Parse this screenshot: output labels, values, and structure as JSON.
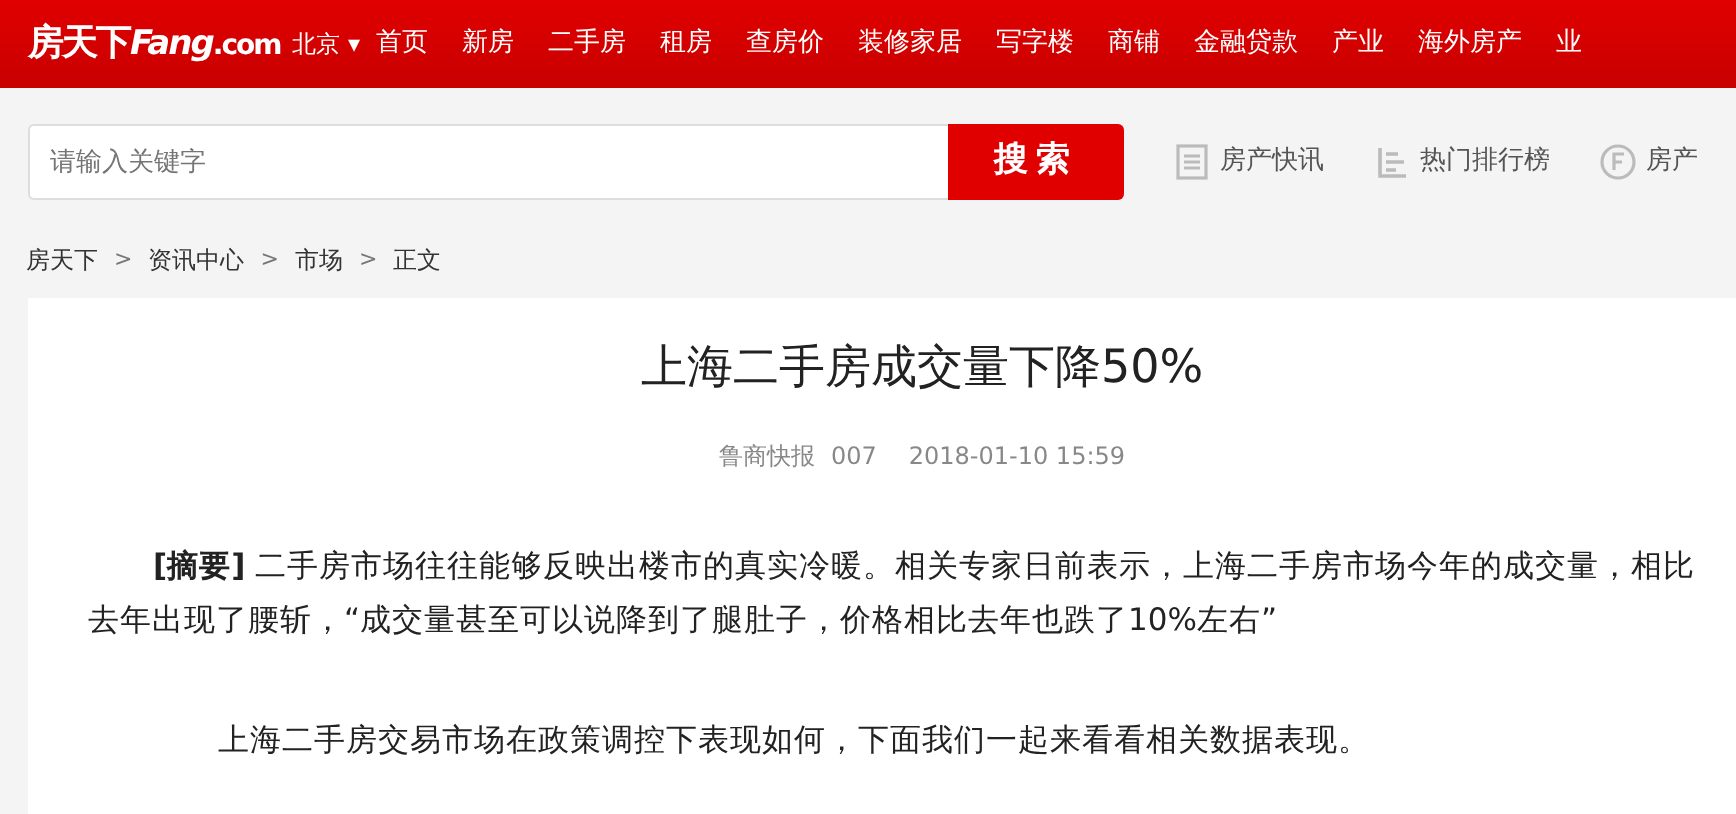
{
  "header": {
    "logo": {
      "cn": "房天下",
      "en": "Fang",
      "domain": ".com"
    },
    "city": "北京",
    "city_caret": "▾",
    "nav": [
      "首页",
      "新房",
      "二手房",
      "租房",
      "查房价",
      "装修家居",
      "写字楼",
      "商铺",
      "金融贷款",
      "产业",
      "海外房产",
      "业"
    ]
  },
  "search": {
    "placeholder": "请输入关键字",
    "button": "搜索"
  },
  "quick_links": [
    {
      "kind": "news",
      "label": "房产快讯"
    },
    {
      "kind": "rank",
      "label": "热门排行榜"
    },
    {
      "kind": "circle",
      "label": "房产"
    }
  ],
  "breadcrumb": [
    {
      "label": "房天下",
      "sep": ">"
    },
    {
      "label": "资讯中心",
      "sep": ">"
    },
    {
      "label": "市场",
      "sep": ">"
    },
    {
      "label": "正文"
    }
  ],
  "article": {
    "title": "上海二手房成交量下降50%",
    "source": "鲁商快报",
    "author": "007",
    "time": "2018-01-10 15:59",
    "paragraphs": [
      {
        "kind": "summary",
        "text": "**[摘要]** 二手房市场往往能够反映出楼市的真实冷暖。相关专家日前表示，上海二手房市场今年的成交量，相比去年出现了腰斩，“成交量甚至可以说降到了腿肚子，价格相比去年也跌了10%左右”"
      },
      {
        "kind": "lead",
        "text": "上海二手房交易市场在政策调控下表现如何，下面我们一起来看看相关数据表现。"
      }
    ]
  }
}
